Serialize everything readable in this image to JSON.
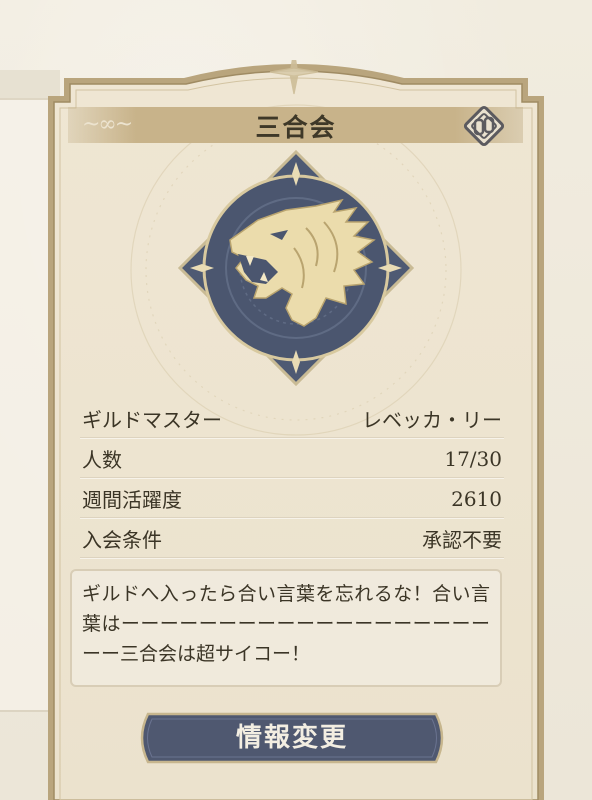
{
  "guild": {
    "name": "三合会",
    "emblem_icon": "lion-head-emblem-icon",
    "edit_icon": "edit-chain-icon"
  },
  "info_rows": [
    {
      "label": "ギルドマスター",
      "value": "レベッカ・リー"
    },
    {
      "label": "人数",
      "value": "17/30"
    },
    {
      "label": "週間活躍度",
      "value": "2610"
    },
    {
      "label": "入会条件",
      "value": "承認不要"
    }
  ],
  "message": "ギルドへ入ったら合い言葉を忘れるな！合い言葉はーーーーーーーーーーーーーーーーーーーーー三合会は超サイコー！",
  "actions": {
    "change_info_label": "情報変更"
  },
  "colors": {
    "frame": "#b9a57d",
    "emblem_bg": "#4e5a73",
    "emblem_gold": "#e6d6a6",
    "button_bg": "#4f5870"
  }
}
